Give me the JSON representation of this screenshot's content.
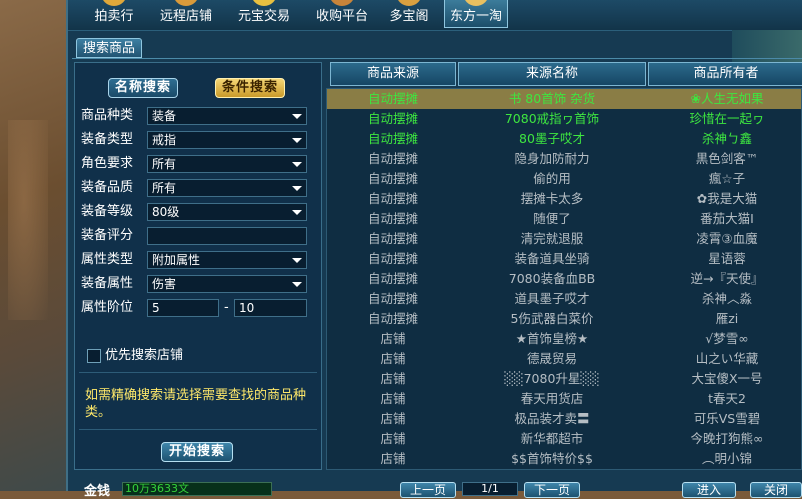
{
  "toolbar": {
    "items": [
      {
        "label": "拍卖行",
        "icon": "auction-icon",
        "color": "#e0a83a"
      },
      {
        "label": "远程店铺",
        "icon": "shop-icon",
        "color": "#d99a3a"
      },
      {
        "label": "元宝交易",
        "icon": "ingot-icon",
        "color": "#e8c040"
      },
      {
        "label": "收购平台",
        "icon": "purchase-icon",
        "color": "#c8843a"
      },
      {
        "label": "多宝阁",
        "icon": "treasure-icon",
        "color": "#d9a040"
      },
      {
        "label": "东方一淘",
        "icon": "magnifier-icon",
        "color": "#e8c060"
      }
    ]
  },
  "tab": {
    "label": "搜索商品"
  },
  "search": {
    "mode_name": "名称搜索",
    "mode_condition": "条件搜索",
    "fields": {
      "category": {
        "label": "商品种类",
        "value": "装备"
      },
      "equip_type": {
        "label": "装备类型",
        "value": "戒指"
      },
      "role": {
        "label": "角色要求",
        "value": "所有"
      },
      "quality": {
        "label": "装备品质",
        "value": "所有"
      },
      "level": {
        "label": "装备等级",
        "value": "80级"
      },
      "score": {
        "label": "装备评分",
        "value": ""
      },
      "attr_type": {
        "label": "属性类型",
        "value": "附加属性"
      },
      "attr": {
        "label": "装备属性",
        "value": "伤害"
      },
      "attr_tier": {
        "label": "属性阶位",
        "min": "5",
        "dash": "-",
        "max": "10"
      }
    },
    "prefer_shop": "优先搜索店铺",
    "hint": "如需精确搜索请选择需要查找的商品种类。",
    "start": "开始搜索"
  },
  "table": {
    "headers": [
      "商品来源",
      "来源名称",
      "商品所有者"
    ],
    "rows": [
      {
        "source": "自动摆摊",
        "name": "书 80首饰 杂货",
        "owner": "❀人生无如果",
        "color": "green",
        "selected": true
      },
      {
        "source": "自动摆摊",
        "name": "7080戒指ヮ首饰",
        "owner": "珍惜在一起ヮ",
        "color": "green",
        "selected": false
      },
      {
        "source": "自动摆摊",
        "name": "80墨子哎才",
        "owner": "杀神ㄅ鑫",
        "color": "green",
        "selected": false
      },
      {
        "source": "自动摆摊",
        "name": "隐身加防耐力",
        "owner": "黒色剑客™",
        "color": "grey",
        "selected": false
      },
      {
        "source": "自动摆摊",
        "name": "偷的用",
        "owner": "瘋☆子",
        "color": "grey",
        "selected": false
      },
      {
        "source": "自动摆摊",
        "name": "摆摊卡太多",
        "owner": "✿我是大猫",
        "color": "grey",
        "selected": false
      },
      {
        "source": "自动摆摊",
        "name": "随便了",
        "owner": "番茄大猫I",
        "color": "grey",
        "selected": false
      },
      {
        "source": "自动摆摊",
        "name": "清完就退服",
        "owner": "凌霄③血魔",
        "color": "grey",
        "selected": false
      },
      {
        "source": "自动摆摊",
        "name": "装备道具坐骑",
        "owner": "星语蓉",
        "color": "grey",
        "selected": false
      },
      {
        "source": "自动摆摊",
        "name": "7080装备血BB",
        "owner": "逆→『天使』",
        "color": "grey",
        "selected": false
      },
      {
        "source": "自动摆摊",
        "name": "道具墨子哎才",
        "owner": "杀神︿淼",
        "color": "grey",
        "selected": false
      },
      {
        "source": "自动摆摊",
        "name": "5伤武器白菜价",
        "owner": "雁zi",
        "color": "grey",
        "selected": false
      },
      {
        "source": "店铺",
        "name": "★首饰皇榜★",
        "owner": "√梦雪∞",
        "color": "grey",
        "selected": false
      },
      {
        "source": "店铺",
        "name": "德晟贸易",
        "owner": "山之い华藏",
        "color": "grey",
        "selected": false
      },
      {
        "source": "店铺",
        "name": "░░7080升星░░",
        "owner": "大宝傻X一号",
        "color": "grey",
        "selected": false
      },
      {
        "source": "店铺",
        "name": "春天用货店",
        "owner": "t春天2",
        "color": "grey",
        "selected": false
      },
      {
        "source": "店铺",
        "name": "极品装才卖〓",
        "owner": "可乐VS雪碧",
        "color": "grey",
        "selected": false
      },
      {
        "source": "店铺",
        "name": "新华都超市",
        "owner": "今晚打狗熊∞",
        "color": "grey",
        "selected": false
      },
      {
        "source": "店铺",
        "name": "$$首饰特价$$",
        "owner": "︵明小锦",
        "color": "grey",
        "selected": false
      }
    ]
  },
  "bottom": {
    "money_label": "金钱",
    "money_value": "10万3633文",
    "prev": "上一页",
    "page": "1/1",
    "next": "下一页",
    "enter": "进入",
    "close": "关闭"
  },
  "colors": {
    "green": "#3ee640",
    "grey": "#b6bec4",
    "selected_row": "#8a7d45",
    "hint": "#ffe96a"
  }
}
